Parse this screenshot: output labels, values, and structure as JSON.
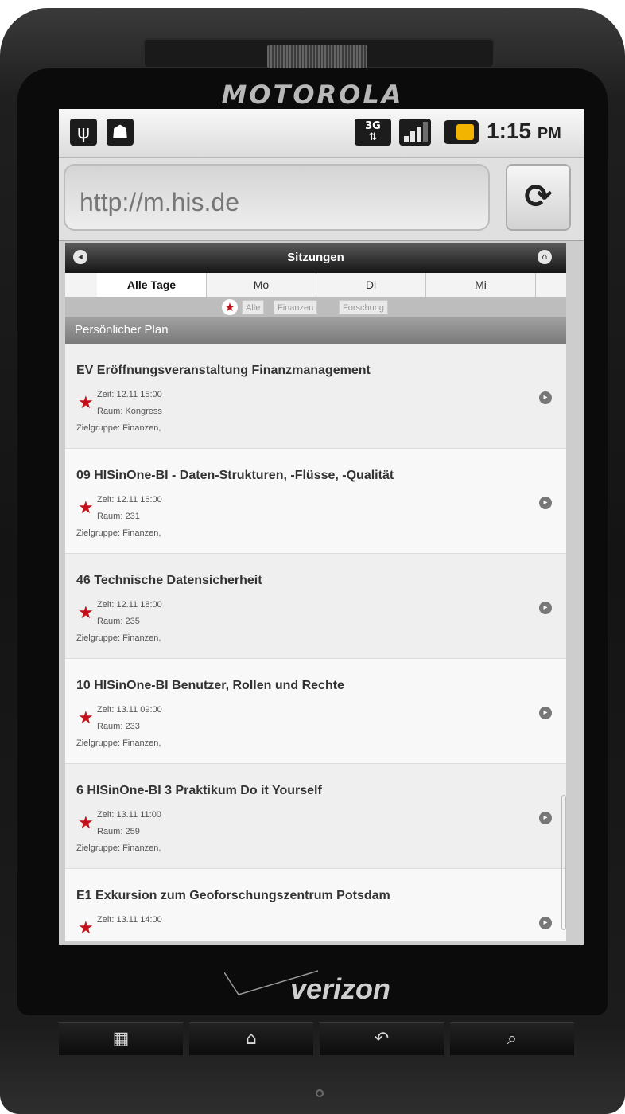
{
  "device": {
    "brand_top": "MOTOROLA",
    "carrier": "verizon"
  },
  "status_bar": {
    "network": "3G",
    "time": "1:15",
    "ampm": "PM"
  },
  "browser": {
    "url": "http://m.his.de"
  },
  "page": {
    "title": "Sitzungen",
    "tabs": [
      {
        "label": "Alle Tage",
        "active": true
      },
      {
        "label": "Mo",
        "active": false
      },
      {
        "label": "Di",
        "active": false
      },
      {
        "label": "Mi",
        "active": false
      }
    ],
    "filters": [
      "Alle",
      "Finanzen",
      "Forschung"
    ],
    "section_header": "Persönlicher Plan",
    "sessions": [
      {
        "title": "EV Eröffnungsveranstaltung Finanzmanagement",
        "zeit": "Zeit: 12.11 15:00",
        "raum": "Raum: Kongress",
        "zielgruppe": "Zielgruppe: Finanzen,"
      },
      {
        "title": "09 HISinOne-BI - Daten-Strukturen, -Flüsse, -Qualität",
        "zeit": "Zeit: 12.11 16:00",
        "raum": "Raum: 231",
        "zielgruppe": "Zielgruppe: Finanzen,"
      },
      {
        "title": "46 Technische Datensicherheit",
        "zeit": "Zeit: 12.11 18:00",
        "raum": "Raum: 235",
        "zielgruppe": "Zielgruppe: Finanzen,"
      },
      {
        "title": "10 HISinOne-BI Benutzer, Rollen und Rechte",
        "zeit": "Zeit: 13.11 09:00",
        "raum": "Raum: 233",
        "zielgruppe": "Zielgruppe: Finanzen,"
      },
      {
        "title": "6 HISinOne-BI 3 Praktikum Do it Yourself",
        "zeit": "Zeit: 13.11 11:00",
        "raum": "Raum: 259",
        "zielgruppe": "Zielgruppe: Finanzen,"
      },
      {
        "title": "E1 Exkursion zum Geoforschungszentrum Potsdam",
        "zeit": "Zeit: 13.11 14:00",
        "raum": "",
        "zielgruppe": ""
      }
    ]
  },
  "icons": {
    "usb": "usb-icon",
    "android": "android-icon",
    "signal": "signal-icon",
    "battery": "battery-icon",
    "reload": "reload-icon",
    "back": "back-icon",
    "home": "home-icon",
    "star": "star-icon",
    "arrow": "chevron-right-icon",
    "menu_key": "menu-icon",
    "home_key": "home-key-icon",
    "back_key": "back-key-icon",
    "search_key": "search-icon"
  },
  "colors": {
    "accent_star": "#c3101a",
    "header_dark": "#151515",
    "battery": "#f2b400"
  }
}
